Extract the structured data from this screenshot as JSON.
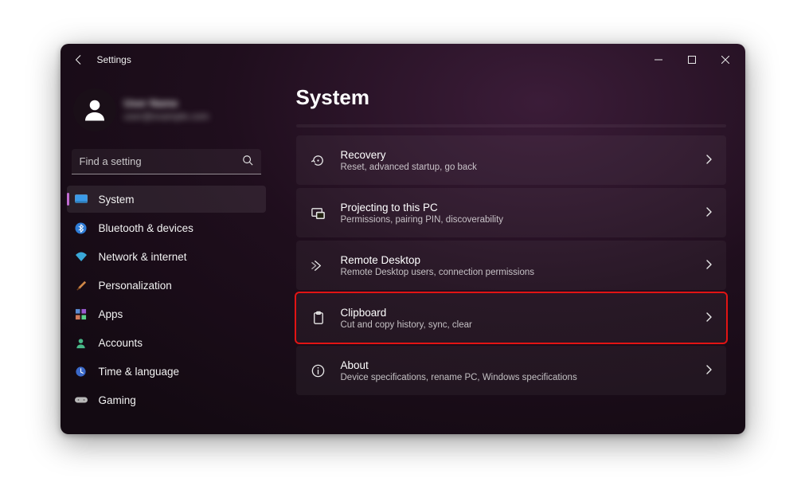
{
  "window": {
    "title": "Settings"
  },
  "profile": {
    "name": "User Name",
    "email": "user@example.com"
  },
  "search": {
    "placeholder": "Find a setting"
  },
  "sidebar": {
    "items": [
      {
        "label": "System"
      },
      {
        "label": "Bluetooth & devices"
      },
      {
        "label": "Network & internet"
      },
      {
        "label": "Personalization"
      },
      {
        "label": "Apps"
      },
      {
        "label": "Accounts"
      },
      {
        "label": "Time & language"
      },
      {
        "label": "Gaming"
      }
    ]
  },
  "page": {
    "title": "System"
  },
  "rows": [
    {
      "title": "Recovery",
      "desc": "Reset, advanced startup, go back"
    },
    {
      "title": "Projecting to this PC",
      "desc": "Permissions, pairing PIN, discoverability"
    },
    {
      "title": "Remote Desktop",
      "desc": "Remote Desktop users, connection permissions"
    },
    {
      "title": "Clipboard",
      "desc": "Cut and copy history, sync, clear"
    },
    {
      "title": "About",
      "desc": "Device specifications, rename PC, Windows specifications"
    }
  ]
}
